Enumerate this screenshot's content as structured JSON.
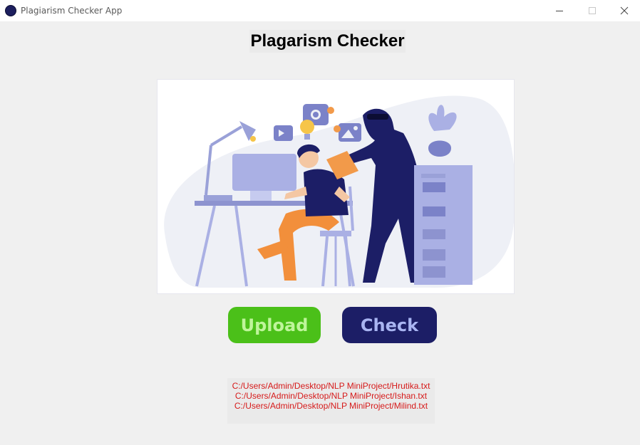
{
  "window": {
    "title": "Plagiarism Checker App",
    "controls": [
      "minimize",
      "maximize",
      "close"
    ]
  },
  "page": {
    "heading": "Plagarism Checker"
  },
  "illustration": {
    "subject": "person-at-desk-with-hooded-figure"
  },
  "buttons": {
    "upload_label": "Upload",
    "check_label": "Check"
  },
  "files": [
    "C:/Users/Admin/Desktop/NLP MiniProject/Hrutika.txt",
    "C:/Users/Admin/Desktop/NLP MiniProject/Ishan.txt",
    "C:/Users/Admin/Desktop/NLP MiniProject/Milind.txt"
  ],
  "colors": {
    "upload_button": "#4bc019",
    "check_button": "#1c1e66",
    "file_text": "#d61a1a",
    "background": "#f0f0f0"
  }
}
